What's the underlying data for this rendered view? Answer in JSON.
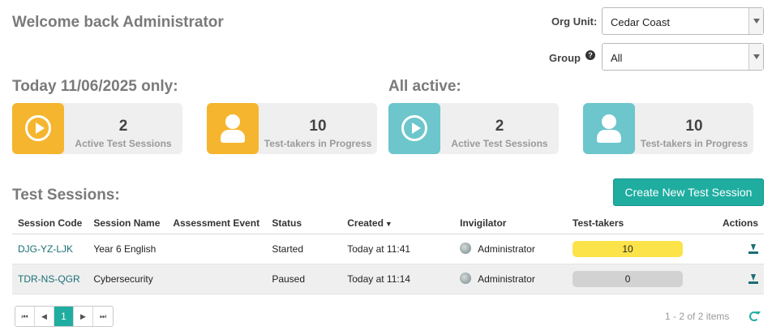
{
  "header": {
    "welcome": "Welcome back Administrator"
  },
  "filters": {
    "org_unit_label": "Org Unit:",
    "org_unit_value": "Cedar Coast",
    "group_label": "Group",
    "group_value": "All",
    "help_glyph": "?"
  },
  "today": {
    "title": "Today 11/06/2025 only:",
    "cards": [
      {
        "value": "2",
        "label": "Active Test Sessions",
        "icon": "play-circle-icon",
        "color": "#f5b52e"
      },
      {
        "value": "10",
        "label": "Test-takers in Progress",
        "icon": "user-icon",
        "color": "#f5b52e"
      }
    ]
  },
  "all_active": {
    "title": "All active:",
    "cards": [
      {
        "value": "2",
        "label": "Active Test Sessions",
        "icon": "play-circle-icon",
        "color": "#6cc6cc"
      },
      {
        "value": "10",
        "label": "Test-takers in Progress",
        "icon": "user-icon",
        "color": "#6cc6cc"
      }
    ]
  },
  "sessions": {
    "title": "Test Sessions:",
    "create_button": "Create New Test Session",
    "columns": [
      "Session Code",
      "Session Name",
      "Assessment Event",
      "Status",
      "Created",
      "Invigilator",
      "Test-takers",
      "Actions"
    ],
    "sort_glyph": "▼",
    "rows": [
      {
        "code": "DJG-YZ-LJK",
        "name": "Year 6 English",
        "event": "",
        "status": "Started",
        "created": "Today at 11:41",
        "invigilator": "Administrator",
        "test_takers": "10",
        "bar_color": "#fde34a"
      },
      {
        "code": "TDR-NS-QGR",
        "name": "Cybersecurity",
        "event": "",
        "status": "Paused",
        "created": "Today at 11:14",
        "invigilator": "Administrator",
        "test_takers": "0",
        "bar_color": "#d2d2d2"
      }
    ]
  },
  "pagination": {
    "first": "⏮",
    "prev": "◀",
    "current": "1",
    "next": "▶",
    "last": "⏭",
    "summary": "1 - 2 of 2 items"
  },
  "colors": {
    "accent": "#1fada0",
    "link": "#1a6f75"
  }
}
